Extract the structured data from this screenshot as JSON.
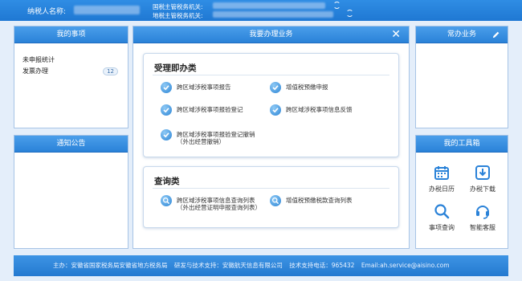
{
  "header": {
    "taxpayer_label": "纳税人名称:",
    "national_bureau_label": "国税主管税务机关:",
    "local_bureau_label": "地税主管税务机关:"
  },
  "my_items": {
    "title": "我的事项",
    "items": [
      {
        "label": "未申报统计",
        "count": ""
      },
      {
        "label": "发票办理",
        "count": "12"
      }
    ]
  },
  "notice": {
    "title": "通知公告"
  },
  "center": {
    "title": "我要办理业务",
    "close_label": "✕",
    "handle": {
      "title": "受理即办类",
      "items": [
        {
          "line1": "跨区域涉税事项报告",
          "line2": ""
        },
        {
          "line1": "增值税预缴申报",
          "line2": ""
        },
        {
          "line1": "跨区域涉税事项报验登记",
          "line2": ""
        },
        {
          "line1": "跨区域涉税事项信息反馈",
          "line2": ""
        },
        {
          "line1": "跨区域涉税事项报验登记撤销",
          "line2": "（外出经营撤销）"
        }
      ]
    },
    "query": {
      "title": "查询类",
      "items": [
        {
          "line1": "跨区域涉税事项信息查询列表",
          "line2": "（外出经营证明申报查询列表）"
        },
        {
          "line1": "增值税预缴税款查询列表",
          "line2": ""
        }
      ]
    }
  },
  "common": {
    "title": "常办业务"
  },
  "tools": {
    "title": "我的工具箱",
    "items": [
      {
        "label": "办税日历",
        "icon": "calendar-icon"
      },
      {
        "label": "办税下载",
        "icon": "download-icon"
      },
      {
        "label": "事项查询",
        "icon": "search-icon"
      },
      {
        "label": "智能客服",
        "icon": "headset-icon"
      }
    ]
  },
  "footer": {
    "host": "主办：安徽省国家税务局安徽省地方税务局",
    "dev": "研发与技术支持：安徽航天信息有限公司",
    "phone": "技术支持电话：965432",
    "email": "Email:ah.service@aisino.com"
  },
  "colors": {
    "accent": "#2a82d8",
    "page_bg": "#e4eefa"
  }
}
